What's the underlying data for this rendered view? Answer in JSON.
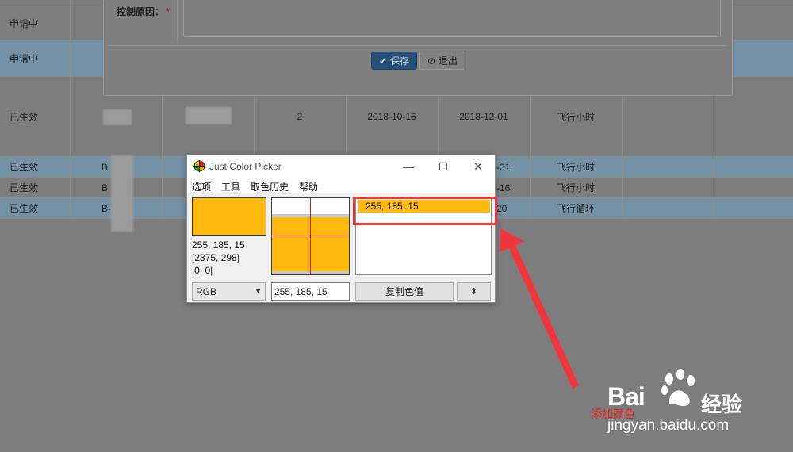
{
  "background_table": {
    "rows": [
      {
        "status": "申请中",
        "cells": []
      },
      {
        "status": "申请中",
        "cells": []
      },
      {
        "status": "已生效",
        "number": "2",
        "date_start": "2018-10-16",
        "date_end": "2018-12-01",
        "unit": "飞行小时"
      },
      {
        "status": "已生效",
        "prefix": "B",
        "date_end": "-31",
        "unit": "飞行小时"
      },
      {
        "status": "已生效",
        "prefix": "B",
        "date_end": "-16",
        "unit": "飞行小时"
      },
      {
        "status": "已生效",
        "prefix": "B-",
        "date_end": "20",
        "unit": "飞行循环"
      }
    ]
  },
  "modal": {
    "field_label": "控制原因：",
    "required_mark": "*",
    "save_label": "保存",
    "exit_label": "退出"
  },
  "picker": {
    "title": "Just Color Picker",
    "menu": [
      "选项",
      "工具",
      "取色历史",
      "帮助"
    ],
    "current_color": "#ffb90f",
    "rgb_text": "255, 185, 15",
    "coords_text": "[2375, 298]",
    "offset_text": "|0, 0|",
    "format_select": "RGB",
    "value_field": "255, 185, 15",
    "history": [
      "255, 185, 15"
    ],
    "copy_button": "复制色值",
    "updown_button": "⬍"
  },
  "annotation": {
    "text": "添加颜色",
    "color": "#f0353d"
  },
  "watermark": {
    "brand": "Bai",
    "cn": "经验",
    "url": "jingyan.baidu.com"
  },
  "icons": [
    "checkmark-icon",
    "ban-icon",
    "color-picker-logo-icon",
    "minimize-icon",
    "maximize-icon",
    "close-icon",
    "chevron-down-icon",
    "paw-icon"
  ]
}
